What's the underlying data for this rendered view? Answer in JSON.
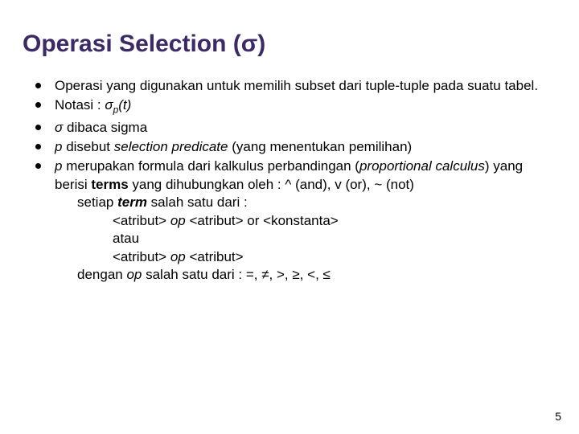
{
  "title": "Operasi Selection (σ)",
  "bullets": {
    "b1": "Operasi yang digunakan untuk memilih subset dari tuple-tuple pada suatu tabel.",
    "b2_prefix": "Notasi : ",
    "b2_sigma": "σ",
    "b2_sub": "p",
    "b2_suffix": "(t)",
    "b3_sigma": "σ",
    "b3_rest": "  dibaca sigma",
    "b4_p": "p",
    "b4_mid": " disebut ",
    "b4_ital": "selection predicate",
    "b4_end": " (yang menentukan pemilihan)",
    "b5_p": "p",
    "b5_mid": " merupakan formula dari kalkulus perbandingan (",
    "b5_ital": "proportional calculus",
    "b5_mid2": ") yang berisi ",
    "b5_terms": "terms",
    "b5_end": " yang dihubungkan oleh : ^ (and), v (or), ~ (not)"
  },
  "sub": {
    "s1_a": "setiap ",
    "s1_b": "term",
    "s1_c": " salah satu dari :",
    "s2_a": "<atribut> ",
    "s2_b": "op",
    "s2_c": " <atribut> or <konstanta>",
    "s3": "atau",
    "s4_a": "<atribut> ",
    "s4_b": "op",
    "s4_c": " <atribut>",
    "s5_a": "dengan ",
    "s5_b": "op",
    "s5_c": "  salah satu dari : =, ≠, >, ≥, <, ≤"
  },
  "page": "5"
}
